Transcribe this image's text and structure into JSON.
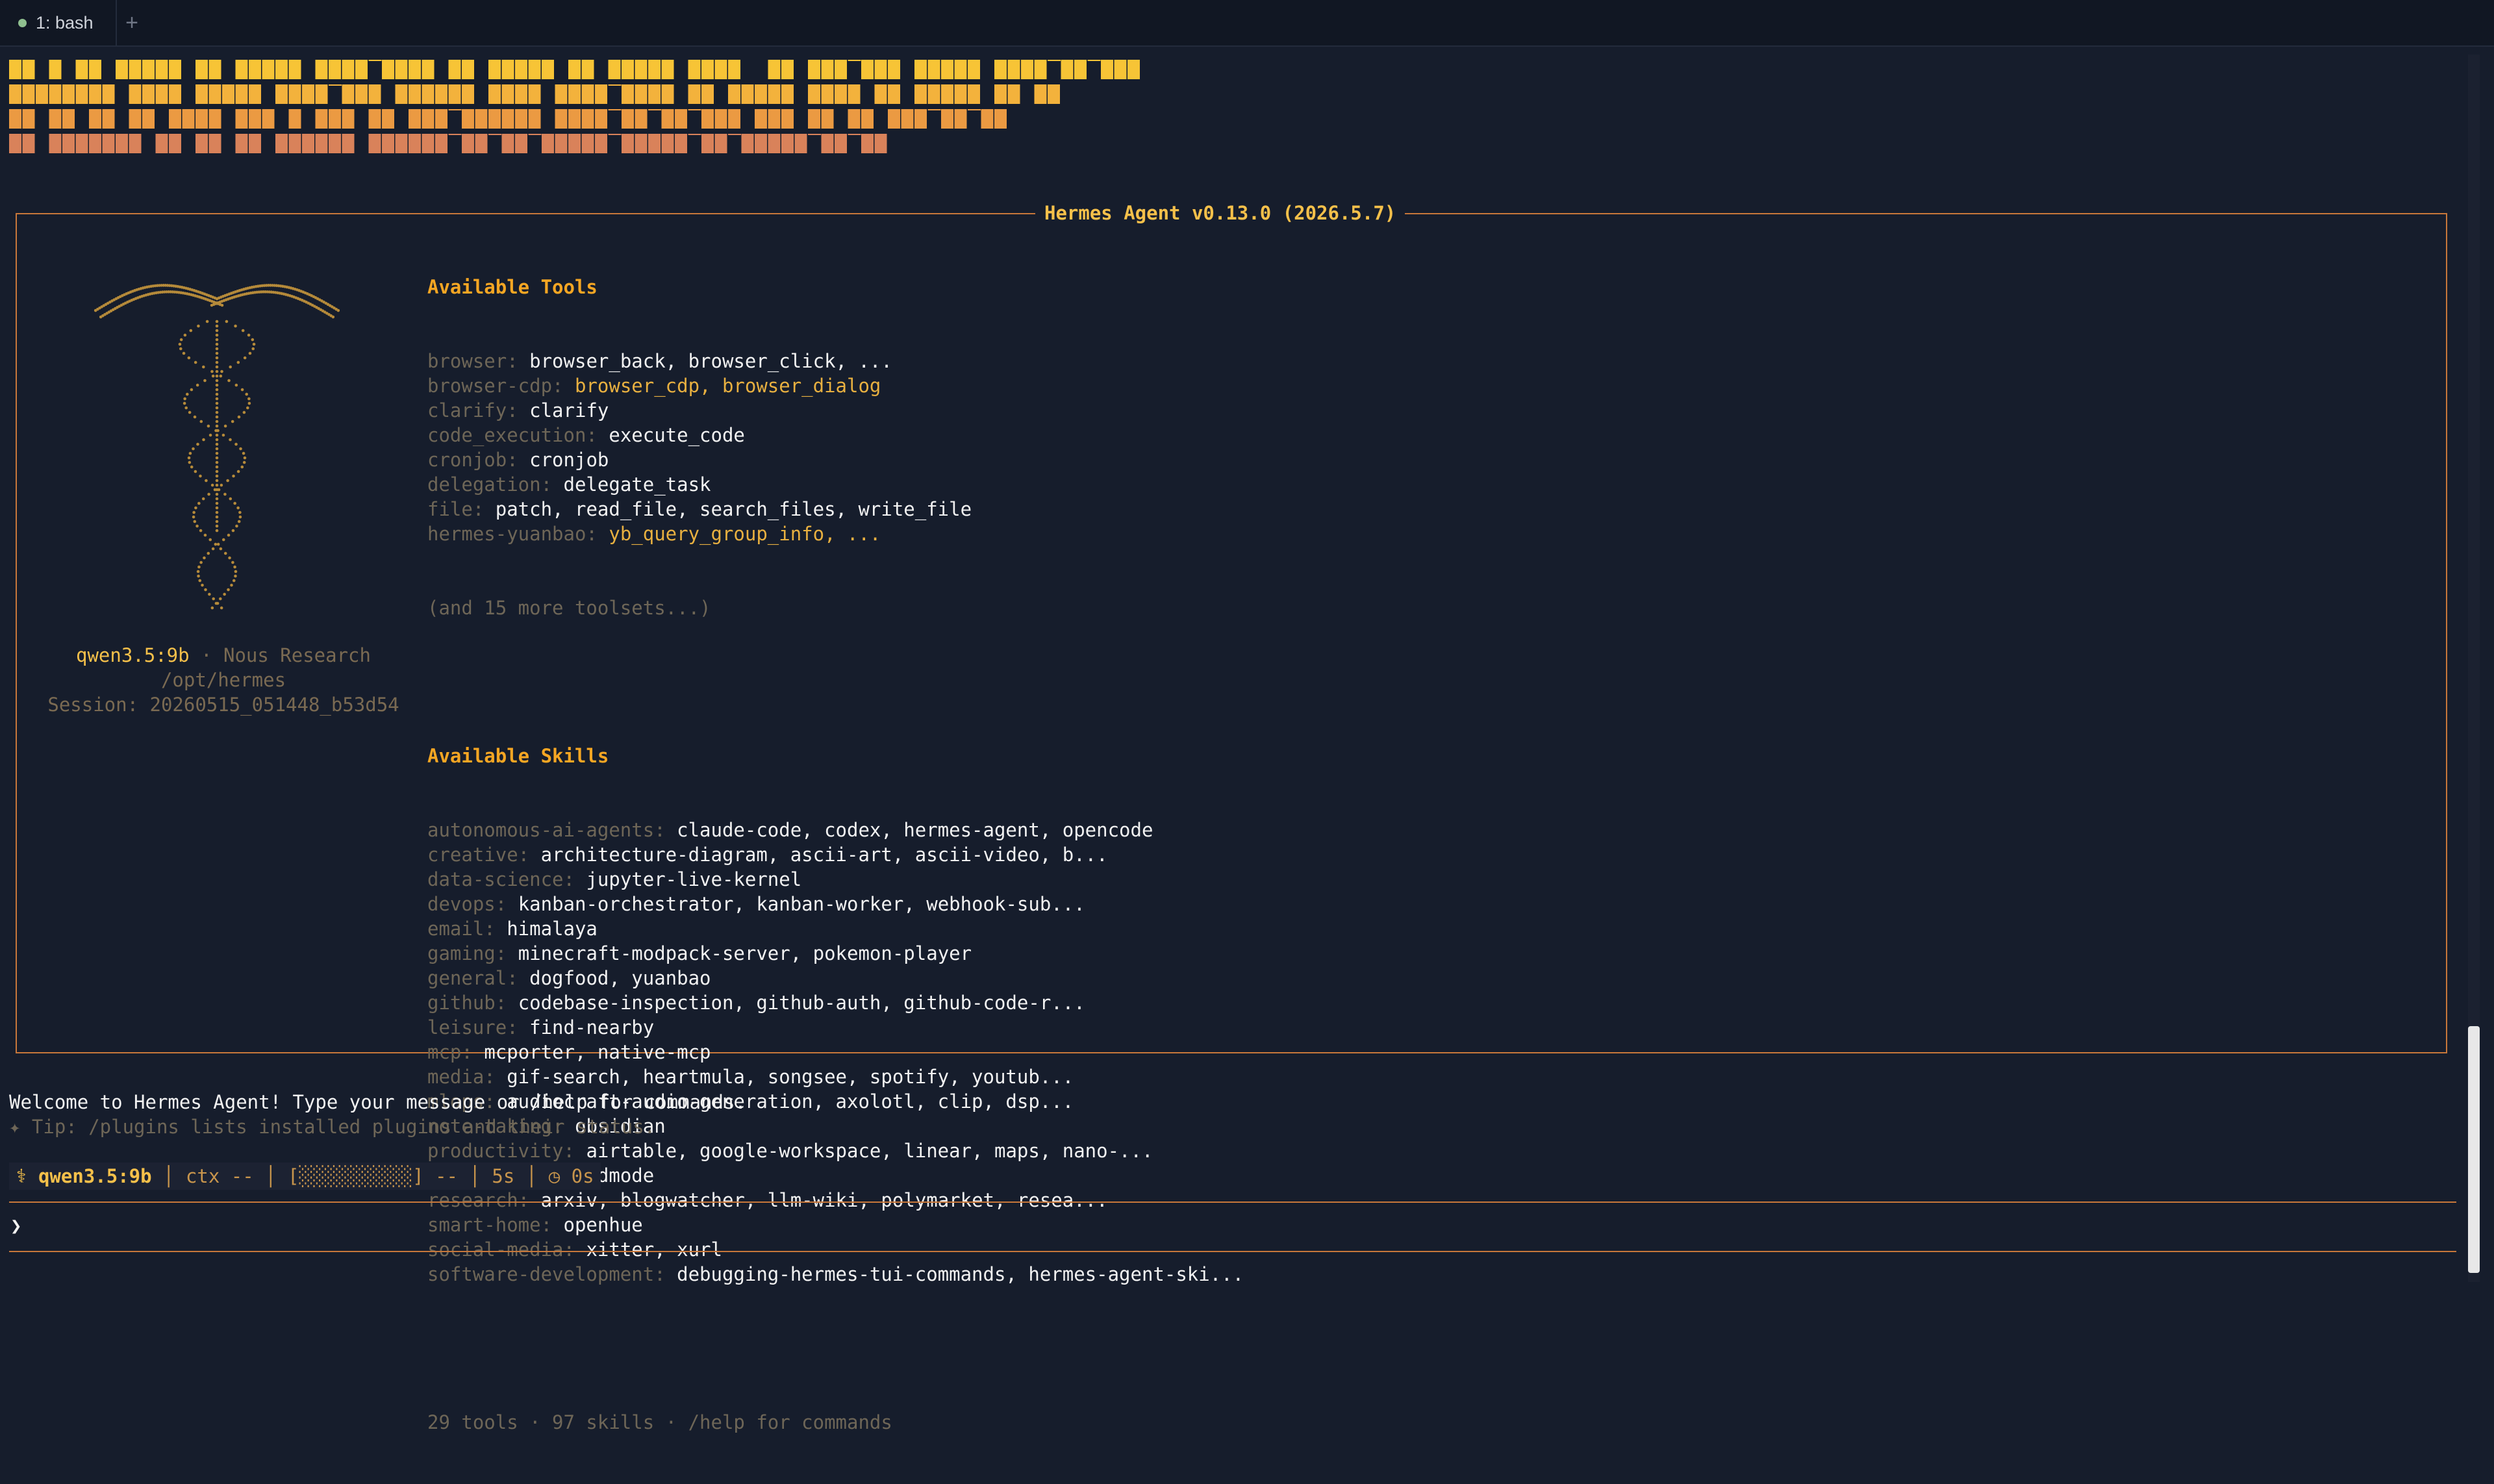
{
  "tabs": {
    "active": "1: bash",
    "add": "+"
  },
  "pane": {
    "title": "Hermes Agent v0.13.0 (2026.5.7)"
  },
  "meta": {
    "model": "qwen3.5:9b",
    "sep": " · ",
    "org": "Nous Research",
    "path": "/opt/hermes",
    "session": "Session: 20260515_051448_b53d54"
  },
  "tools": {
    "heading": "Available Tools",
    "items": [
      {
        "k": "browser: ",
        "v": "browser_back, browser_click, ...",
        "hl": false
      },
      {
        "k": "browser-cdp: ",
        "v": "browser_cdp, browser_dialog",
        "hl": true
      },
      {
        "k": "clarify: ",
        "v": "clarify",
        "hl": false
      },
      {
        "k": "code_execution: ",
        "v": "execute_code",
        "hl": false
      },
      {
        "k": "cronjob: ",
        "v": "cronjob",
        "hl": false
      },
      {
        "k": "delegation: ",
        "v": "delegate_task",
        "hl": false
      },
      {
        "k": "file: ",
        "v": "patch, read_file, search_files, write_file",
        "hl": false
      },
      {
        "k": "hermes-yuanbao: ",
        "v": "yb_query_group_info, ...",
        "hl": true
      }
    ],
    "more": "(and 15 more toolsets...)"
  },
  "skills": {
    "heading": "Available Skills",
    "items": [
      {
        "k": "autonomous-ai-agents: ",
        "v": "claude-code, codex, hermes-agent, opencode"
      },
      {
        "k": "creative: ",
        "v": "architecture-diagram, ascii-art, ascii-video, b..."
      },
      {
        "k": "data-science: ",
        "v": "jupyter-live-kernel"
      },
      {
        "k": "devops: ",
        "v": "kanban-orchestrator, kanban-worker, webhook-sub..."
      },
      {
        "k": "email: ",
        "v": "himalaya"
      },
      {
        "k": "gaming: ",
        "v": "minecraft-modpack-server, pokemon-player"
      },
      {
        "k": "general: ",
        "v": "dogfood, yuanbao"
      },
      {
        "k": "github: ",
        "v": "codebase-inspection, github-auth, github-code-r..."
      },
      {
        "k": "leisure: ",
        "v": "find-nearby"
      },
      {
        "k": "mcp: ",
        "v": "mcporter, native-mcp"
      },
      {
        "k": "media: ",
        "v": "gif-search, heartmula, songsee, spotify, youtub..."
      },
      {
        "k": "mlops: ",
        "v": "audiocraft-audio-generation, axolotl, clip, dsp..."
      },
      {
        "k": "note-taking: ",
        "v": "obsidian"
      },
      {
        "k": "productivity: ",
        "v": "airtable, google-workspace, linear, maps, nano-..."
      },
      {
        "k": "red-teaming: ",
        "v": "godmode"
      },
      {
        "k": "research: ",
        "v": "arxiv, blogwatcher, llm-wiki, polymarket, resea..."
      },
      {
        "k": "smart-home: ",
        "v": "openhue"
      },
      {
        "k": "social-media: ",
        "v": "xitter, xurl"
      },
      {
        "k": "software-development: ",
        "v": "debugging-hermes-tui-commands, hermes-agent-ski..."
      }
    ]
  },
  "summary": "29 tools · 97 skills · /help for commands",
  "welcome": "Welcome to Hermes Agent! Type your message or /help for commands.",
  "tip": "✦ Tip: /plugins lists installed plugins and their status.",
  "status": {
    "icon": "⚕",
    "model": "qwen3.5:9b",
    "ctx": "ctx --",
    "bar": "[░░░░░░░░░░]",
    "bar_val": "--",
    "time": "5s",
    "timer_icon": "◷",
    "elapsed": "0s"
  },
  "prompt": "❯"
}
